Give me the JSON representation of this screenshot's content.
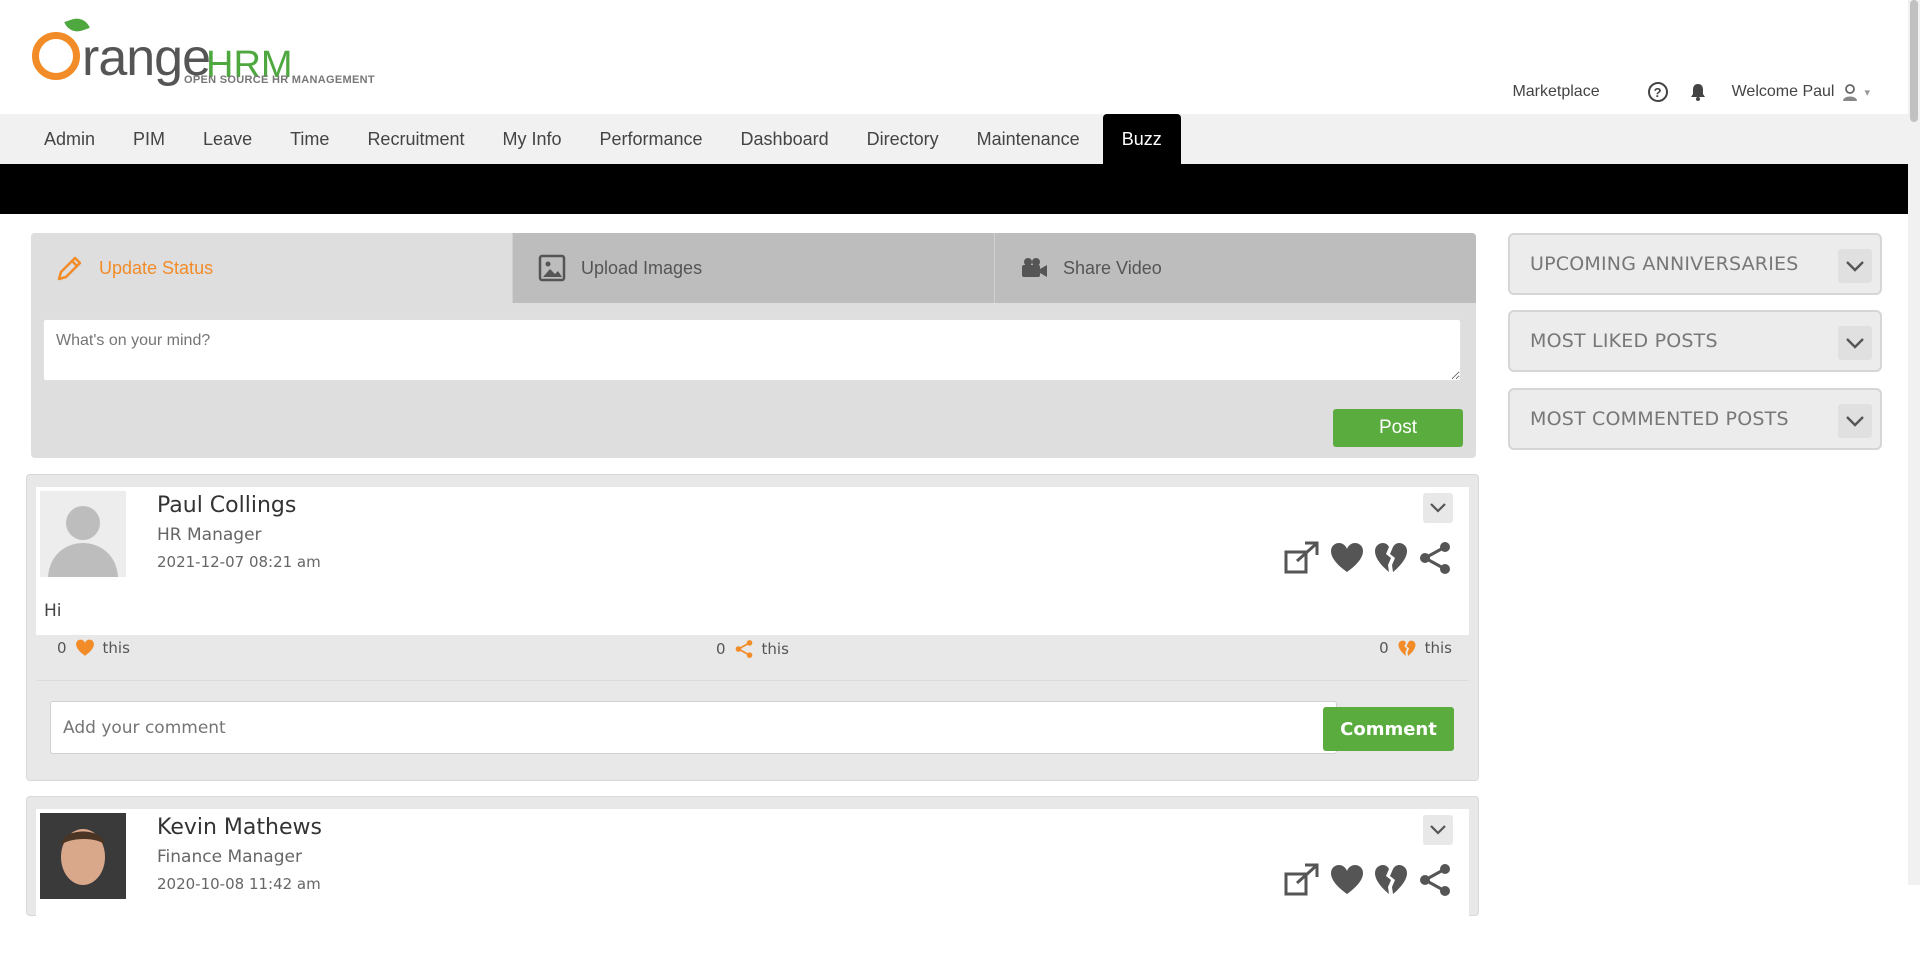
{
  "header": {
    "logo": {
      "brand_o": "O",
      "brand_range": "range",
      "brand_hrm": "HRM",
      "tagline": "OPEN SOURCE HR MANAGEMENT"
    },
    "marketplace": "Marketplace",
    "help_glyph": "?",
    "welcome": "Welcome Paul",
    "caret": "▾"
  },
  "menu": {
    "items": [
      "Admin",
      "PIM",
      "Leave",
      "Time",
      "Recruitment",
      "My Info",
      "Performance",
      "Dashboard",
      "Directory",
      "Maintenance",
      "Buzz"
    ],
    "active": "Buzz"
  },
  "status": {
    "tabs": [
      "Update Status",
      "Upload Images",
      "Share Video"
    ],
    "placeholder": "What's on your mind?",
    "post_label": "Post"
  },
  "posts": [
    {
      "name": "Paul Collings",
      "job": "HR Manager",
      "date": "2021-12-07  08:21 am",
      "text": "Hi",
      "likes": "0",
      "shares": "0",
      "dislikes": "0",
      "this_label": "this",
      "comment_placeholder": "Add your comment",
      "comment_label": "Comment"
    },
    {
      "name": "Kevin Mathews",
      "job": "Finance Manager",
      "date": "2020-10-08  11:42 am"
    }
  ],
  "sidebar": {
    "widgets": [
      "UPCOMING ANNIVERSARIES",
      "MOST LIKED POSTS",
      "MOST COMMENTED POSTS"
    ]
  },
  "colors": {
    "accent_orange": "#f28c28",
    "brand_green": "#5aac3f",
    "menu_active_bg": "#000000"
  }
}
